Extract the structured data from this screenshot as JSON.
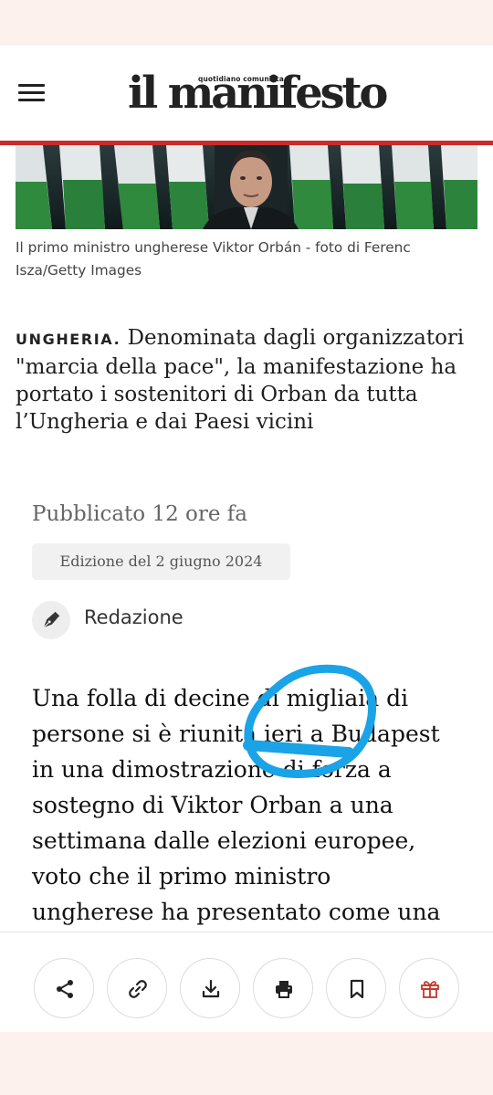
{
  "header": {
    "logo_tagline": "quotidiano comunista",
    "logo_name": "il manifesto",
    "menu_icon": "hamburger-menu-icon"
  },
  "photo": {
    "caption": "Il primo ministro ungherese Viktor Orbán - foto di Ferenc Isza/Getty Images"
  },
  "article": {
    "tag": "UNGHERIA.",
    "summary": "Denominata dagli organizzatori \"marcia della pace\", la manifestazione ha portato i sostenitori di Orban da tutta l’Ungheria e dai Paesi vicini",
    "published": "Pubblicato 12 ore fa",
    "edition": "Edizione del 2 giugno 2024",
    "author": "Redazione",
    "author_icon": "pen-nib-icon",
    "body_lines": [
      "Una folla di decine di migliaia di",
      "persone si è riunita ieri a Budapest",
      "in una dimostrazione di forza a",
      "sostegno di Viktor Orban a una",
      "settimana dalle elezioni europee,",
      "voto che il primo ministro",
      "ungherese ha presentato come una"
    ]
  },
  "toolbar": {
    "buttons": [
      {
        "name": "share",
        "icon": "share-icon"
      },
      {
        "name": "link",
        "icon": "link-icon"
      },
      {
        "name": "download",
        "icon": "download-icon"
      },
      {
        "name": "print",
        "icon": "print-icon"
      },
      {
        "name": "bookmark",
        "icon": "bookmark-icon"
      },
      {
        "name": "gift",
        "icon": "gift-icon"
      }
    ]
  },
  "colors": {
    "accent_red": "#c92b2b",
    "annotation_blue": "#1aa3e6",
    "gift_red": "#c0392b",
    "page_background": "#fdf1ee"
  }
}
